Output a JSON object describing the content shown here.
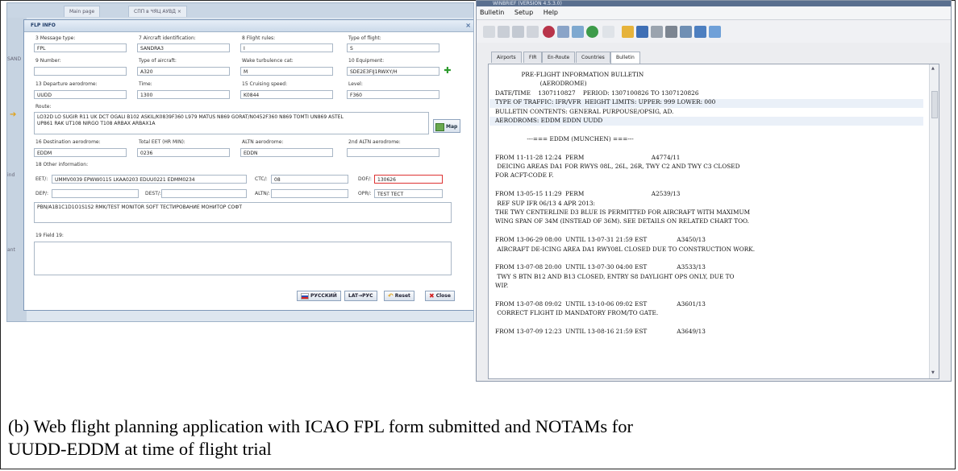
{
  "left": {
    "bg_tabs": [
      "Main page",
      "СПП в ЧЯЦ АУВД ×"
    ],
    "side_labels": [
      "SAND",
      "ind",
      "ant"
    ],
    "dialog_title": "FLP INFO",
    "close_glyph": "×",
    "labels": {
      "msg_type": "3 Message type:",
      "aircraft_id": "7 Aircraft identification:",
      "flight_rules": "8 Flight rules:",
      "type_flight": "Type of flight:",
      "number": "9 Number:",
      "type_aircraft": "Type of aircraft:",
      "wake": "Wake turbulence cat:",
      "equipment": "10 Equipment:",
      "dep_aero": "13 Departure aerodrome:",
      "time": "Time:",
      "cruise_speed": "15 Cruising speed:",
      "level": "Level:",
      "route": "Route:",
      "dest_aero": "16 Destination aerodrome:",
      "total_eet": "Total EET (HR MIN):",
      "altn_aero": "ALTN aerodrome:",
      "altn2_aero": "2nd ALTN aerodrome:",
      "other_info": "18 Other information:",
      "eet": "EET/:",
      "ctc": "CTC/:",
      "dof": "DOF/:",
      "dep": "DEP/:",
      "dest": "DEST/:",
      "altn": "ALTN/:",
      "opr": "OPR/:",
      "field19": "19 Field 19:"
    },
    "values": {
      "msg_type": "FPL",
      "aircraft_id": "SANDRA3",
      "flight_rules": "I",
      "type_flight": "S",
      "number": "",
      "type_aircraft": "A320",
      "wake": "M",
      "equipment": "SDE2E3FIJ1RWXY/H",
      "dep_aero": "UUDD",
      "time": "1300",
      "cruise_speed": "K0844",
      "level": "F360",
      "route_line1": "LO32D LO SUGIR R11 UK DCT OGALI B102 ASKIL/K0839F360 L979 MATUS N869 GORAT/N0452F360 N869 TOMTI UN869 ASTEL",
      "route_line2": "UP861 RAK UT108 NIRGO T108 ARBAX ARBAX1A",
      "dest_aero": "EDDM",
      "total_eet": "0236",
      "altn_aero": "EDDN",
      "altn2_aero": "",
      "eet": "UMMV0039 EPWW0115 LKAA0203 EDUU0221 EDMM0234",
      "ctc": "08",
      "dof": "130626",
      "dep": "",
      "dest": "",
      "altn": "",
      "opr": "TEST TECT",
      "remarks": "PBN/A1B1C1D1O1S1S2 RMK/TEST MONITOR SOFT ТЕСТИРОВАНИЕ МОНИТОР СОФТ",
      "field19": ""
    },
    "buttons": {
      "map": "Map",
      "russian": "РУССКИЙ",
      "lat_rus": "LAT→РУС",
      "reset": "Reset",
      "close": "Close"
    }
  },
  "right": {
    "window_title": "WINBRIEF (VERSION 4.5.3.0)",
    "menu": [
      "Bulletin",
      "Setup",
      "Help"
    ],
    "tabs": [
      "Airports",
      "FIR",
      "En-Route",
      "Countries",
      "Bulletin"
    ],
    "active_tab": "Bulletin",
    "toolbar_icons": [
      "new-icon",
      "open-icon",
      "save-icon",
      "copy-icon",
      "flag-icon",
      "cut-icon",
      "filter-icon",
      "globe-icon",
      "page-icon",
      "folder-icon",
      "disk-icon",
      "print-icon",
      "delete-icon",
      "tools-icon",
      "export-icon",
      "monitor-icon"
    ],
    "bulletin_lines": [
      "              PRE-FLIGHT INFORMATION BULLETIN",
      "                        (AERODROME)",
      "DATE/TIME    1307110827    PERIOD: 1307100826 TO 1307120826",
      "TYPE OF TRAFFIC: IFR/VFR  HEIGHT LIMITS: UPPER: 999 LOWER: 000",
      "BULLETIN CONTENTS: GENERAL PURPOUSE/OPSIG, AD.",
      "AERODROMS: EDDM EDDN UUDD",
      "",
      "                 ---=== EDDM (MUNCHEN) ===---",
      "",
      "FROM 11-11-28 12:24  PERM                                    A4774/11",
      " DEICING AREAS DA1 FOR RWYS 08L, 26L, 26R, TWY C2 AND TWY C3 CLOSED",
      "FOR ACFT-CODE F.",
      "",
      "FROM 13-05-15 11:29  PERM                                    A2539/13",
      " REF SUP IFR 06/13 4 APR 2013:",
      "THE TWY CENTERLINE D3 BLUE IS PERMITTED FOR AIRCRAFT WITH MAXIMUM",
      "WING SPAN OF 34M (INSTEAD OF 36M). SEE DETAILS ON RELATED CHART TOO.",
      "",
      "FROM 13-06-29 08:00  UNTIL 13-07-31 21:59 EST                A3450/13",
      " AIRCRAFT DE-ICING AREA DA1 RWY08L CLOSED DUE TO CONSTRUCTION WORK.",
      "",
      "FROM 13-07-08 20:00  UNTIL 13-07-30 04:00 EST                A3533/13",
      " TWY S BTN B12 AND B13 CLOSED, ENTRY S8 DAYLIGHT OPS ONLY, DUE TO",
      "WIP.",
      "",
      "FROM 13-07-08 09:02  UNTIL 13-10-06 09:02 EST                A3601/13",
      " CORRECT FLIGHT ID MANDATORY FROM/TO GATE.",
      "",
      "FROM 13-07-09 12:23  UNTIL 13-08-16 21:59 EST                A3649/13"
    ]
  },
  "caption": {
    "line1": "(b) Web flight planning application with ICAO FPL form submitted and NOTAMs for",
    "line2": "UUDD-EDDM at time of flight trial"
  },
  "colors": {
    "dialog_title": "#1d3a66",
    "dof_border": "#dd3333",
    "close_icon": "#d21f1f",
    "add_icon": "#2e9b2e"
  }
}
